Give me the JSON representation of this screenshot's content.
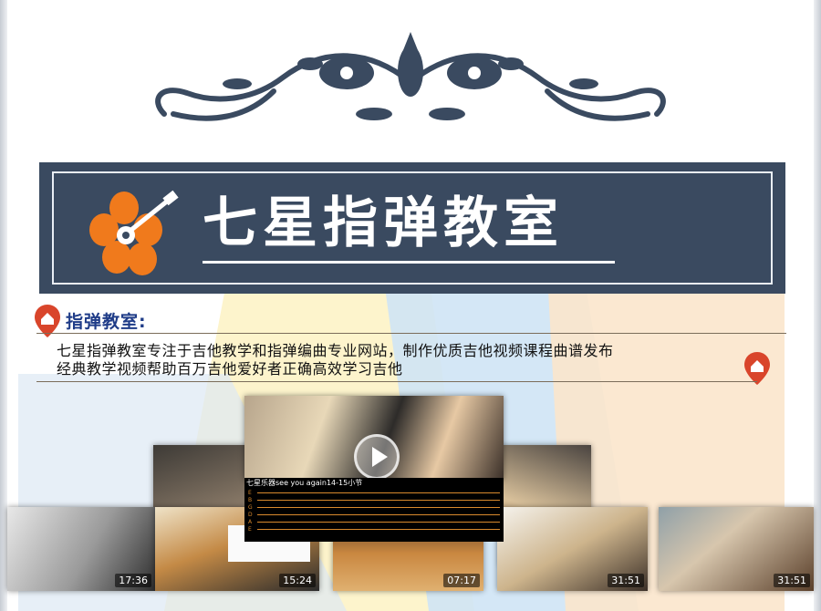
{
  "brand": {
    "title": "七星指弹教室",
    "accent": "#3a4a60",
    "logo_icon": "hibiscus-guitar-icon",
    "ornament_icon": "floral-scroll-ornament"
  },
  "section": {
    "heading": "指弹教室:",
    "pin_icon": "location-pin-icon",
    "pin_color": "#d9452b"
  },
  "description": {
    "line1": "七星指弹教室专注于吉他教学和指弹编曲专业网站，制作优质吉他视频课程曲谱发布",
    "line2": "经典教学视频帮助百万吉他爱好者正确高效学习吉他"
  },
  "featured_video": {
    "caption": "七星乐器see you again14-15小节",
    "play_icon": "play-icon"
  },
  "thumbnails": [
    {
      "duration": "17:36"
    },
    {
      "duration": "15:24"
    },
    {
      "duration": "07:17"
    },
    {
      "duration": "31:51"
    },
    {
      "duration": "31:51"
    }
  ],
  "tab_strings": [
    "E",
    "B",
    "G",
    "D",
    "A",
    "E"
  ]
}
